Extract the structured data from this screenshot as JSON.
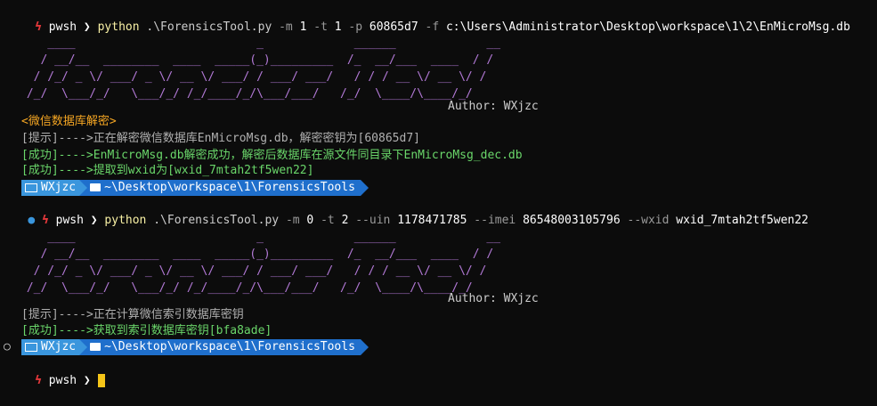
{
  "colors": {
    "background": "#0c0c0c",
    "accent_blue": "#3a96dd",
    "path_blue": "#1f6fcc",
    "bolt_red": "#e5383b",
    "ascii_purple": "#b279d6",
    "success_green": "#6ad66a",
    "info_gray": "#b0b0b0",
    "cursor": "#f5c518"
  },
  "prompt": {
    "shell": "pwsh",
    "user": "WXjzc",
    "path": "~\\Desktop\\workspace\\1\\ForensicsTools"
  },
  "cmd1": {
    "program": "python",
    "script": ".\\ForensicsTool.py",
    "parts": [
      "-m",
      "1",
      "-t",
      "1",
      "-p",
      "60865d7",
      "-f",
      "c:\\Users\\Administrator\\Desktop\\workspace\\1\\2\\EnMicroMsg.db"
    ]
  },
  "cmd2": {
    "program": "python",
    "script": ".\\ForensicsTool.py",
    "parts": [
      "-m",
      "0",
      "-t",
      "2",
      "--uin",
      "1178471785",
      "--imei",
      "86548003105796",
      "--wxid",
      "wxid_7mtah2tf5wen22"
    ]
  },
  "banner": {
    "ascii": "    ____                          _             ______             __\n   / __/__  ________  ____  _____(_)_________  /_  __/___  ____  / /\n  / /_/ _ \\/ ___/ _ \\/ __ \\/ ___/ / ___/ ___/   / / / __ \\/ __ \\/ /\n /_/  \\___/_/   \\___/_/ /_/____/_/\\___/___/   /_/  \\____/\\____/_/",
    "author": "Author: WXjzc"
  },
  "output1": {
    "header": "<微信数据库解密>",
    "lines": [
      {
        "text": "[提示]---->正在解密微信数据库EnMicroMsg.db，解密密钥为[60865d7]",
        "kind": "info"
      },
      {
        "text": "[成功]---->EnMicroMsg.db解密成功，解密后数据库在源文件同目录下EnMicroMsg_dec.db",
        "kind": "success"
      },
      {
        "text": "[成功]---->提取到wxid为[wxid_7mtah2tf5wen22]",
        "kind": "success"
      }
    ]
  },
  "output2": {
    "lines": [
      {
        "text": "[提示]---->正在计算微信索引数据库密钥",
        "kind": "info"
      },
      {
        "text": "[成功]---->获取到索引数据库密钥[bfa8ade]",
        "kind": "success"
      }
    ]
  }
}
